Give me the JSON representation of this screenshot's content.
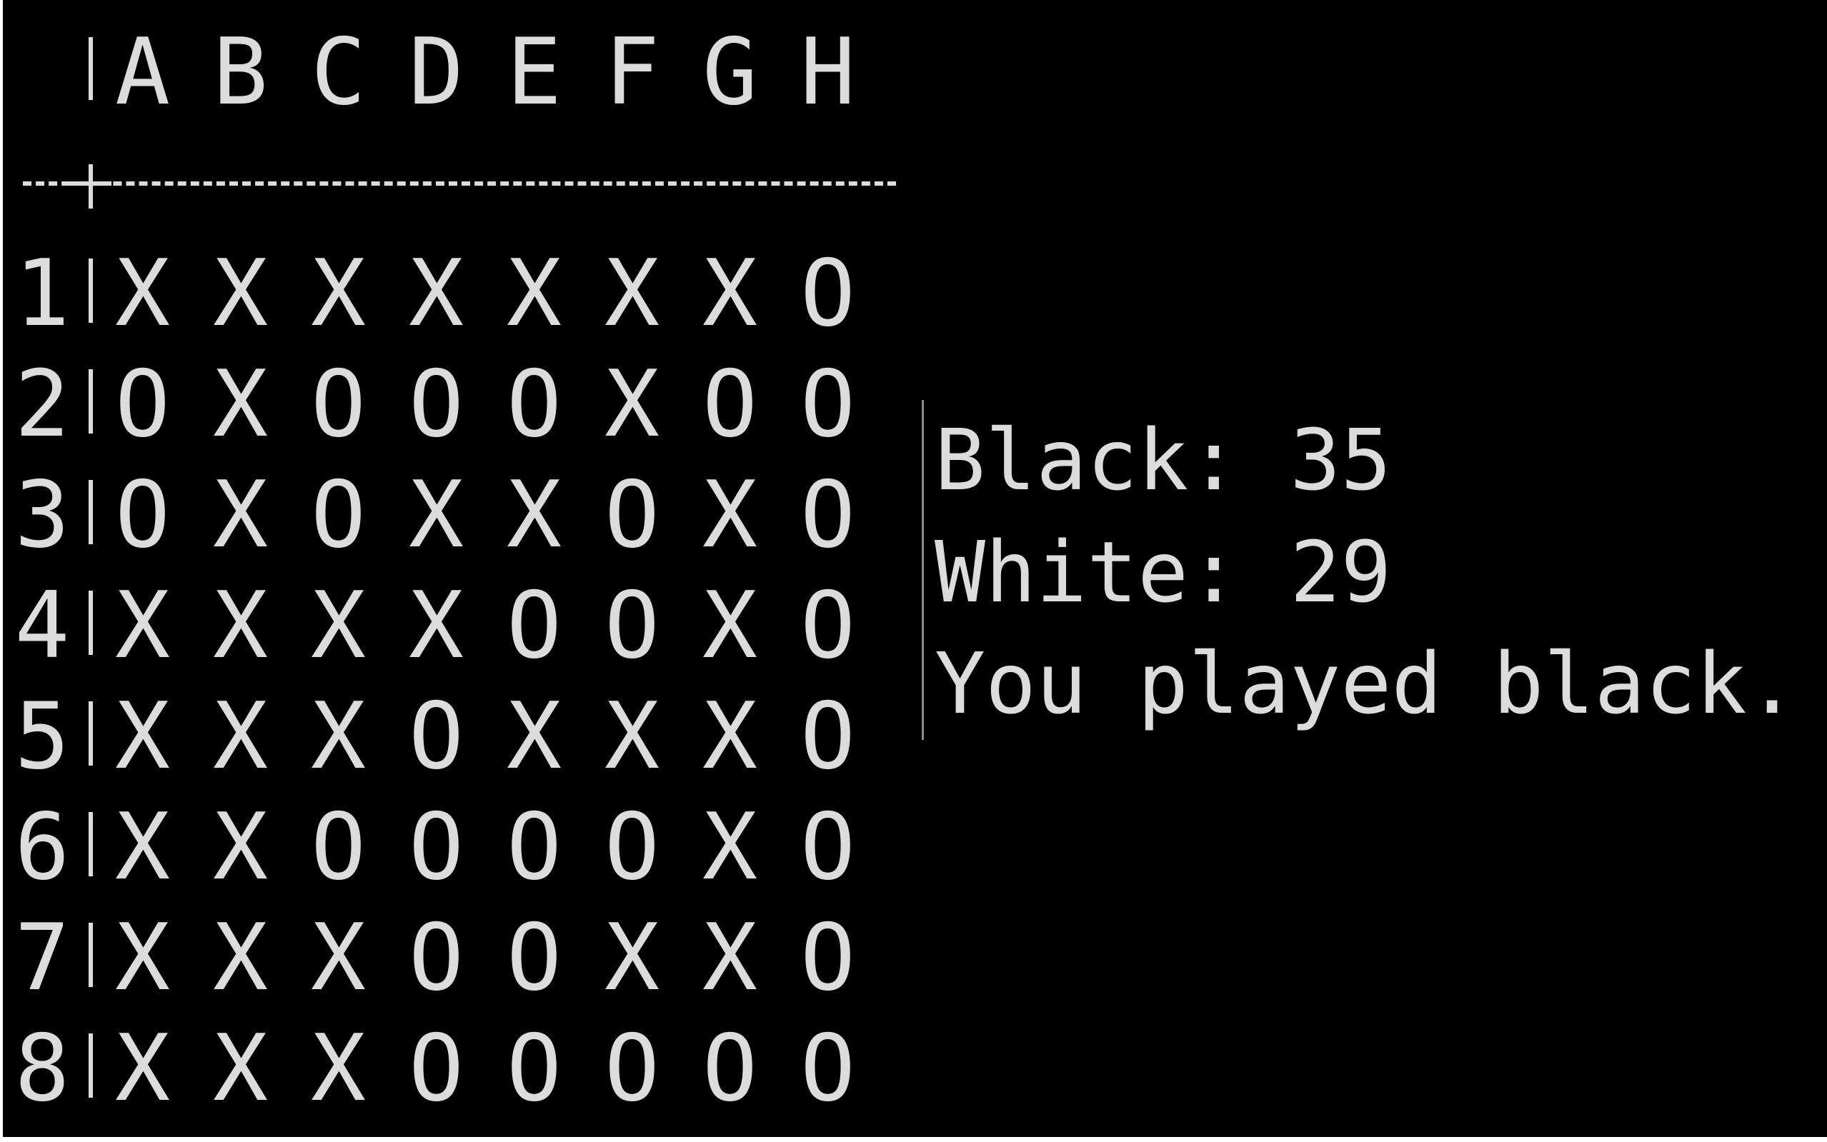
{
  "board": {
    "columns": [
      "A",
      "B",
      "C",
      "D",
      "E",
      "F",
      "G",
      "H"
    ],
    "rows": [
      {
        "label": "1",
        "cells": [
          "X",
          "X",
          "X",
          "X",
          "X",
          "X",
          "X",
          "O"
        ]
      },
      {
        "label": "2",
        "cells": [
          "O",
          "X",
          "O",
          "O",
          "O",
          "X",
          "O",
          "O"
        ]
      },
      {
        "label": "3",
        "cells": [
          "O",
          "X",
          "O",
          "X",
          "X",
          "O",
          "X",
          "O"
        ]
      },
      {
        "label": "4",
        "cells": [
          "X",
          "X",
          "X",
          "X",
          "O",
          "O",
          "X",
          "O"
        ]
      },
      {
        "label": "5",
        "cells": [
          "X",
          "X",
          "X",
          "O",
          "X",
          "X",
          "X",
          "O"
        ]
      },
      {
        "label": "6",
        "cells": [
          "X",
          "X",
          "O",
          "O",
          "O",
          "O",
          "X",
          "O"
        ]
      },
      {
        "label": "7",
        "cells": [
          "X",
          "X",
          "X",
          "O",
          "O",
          "X",
          "X",
          "O"
        ]
      },
      {
        "label": "8",
        "cells": [
          "X",
          "X",
          "X",
          "O",
          "O",
          "O",
          "O",
          "O"
        ]
      }
    ]
  },
  "info": {
    "black_score": "Black: 35",
    "white_score": "White: 29",
    "result_message": "You played black."
  }
}
